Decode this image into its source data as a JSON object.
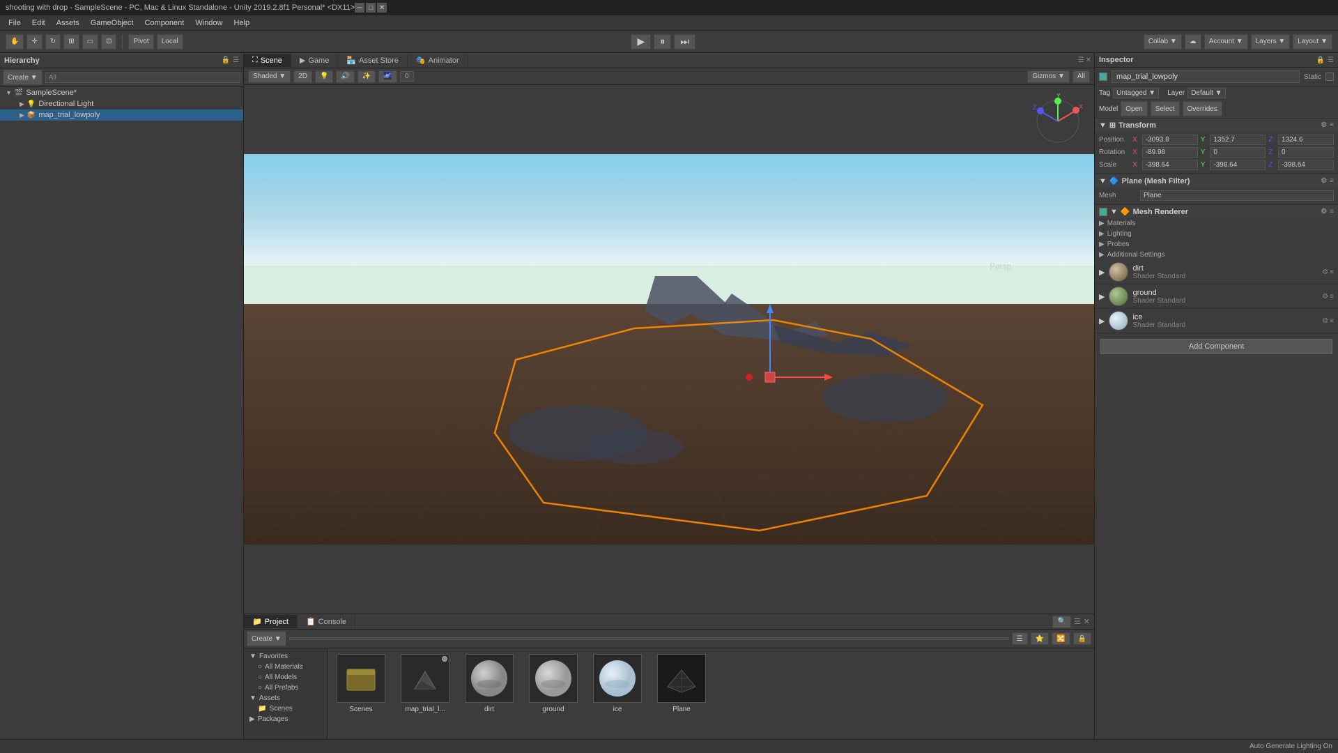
{
  "window": {
    "title": "shooting with drop - SampleScene - PC, Mac & Linux Standalone - Unity 2019.2.8f1 Personal* <DX11>"
  },
  "titlebar": {
    "title": "shooting with drop - SampleScene - PC, Mac & Linux Standalone - Unity 2019.2.8f1 Personal* <DX11>",
    "minimize": "─",
    "maximize": "□",
    "close": "✕"
  },
  "menubar": {
    "items": [
      "File",
      "Edit",
      "Assets",
      "GameObject",
      "Component",
      "Window",
      "Help"
    ]
  },
  "toolbar": {
    "pivot_label": "Pivot",
    "local_label": "Local",
    "collab_label": "Collab ▼",
    "cloud_label": "☁",
    "account_label": "Account ▼",
    "layers_label": "Layers ▼",
    "layout_label": "Layout ▼"
  },
  "hierarchy": {
    "panel_title": "Hierarchy",
    "create_label": "Create ▼",
    "search_placeholder": "All",
    "items": [
      {
        "name": "SampleScene*",
        "level": 0,
        "expanded": true
      },
      {
        "name": "Directional Light",
        "level": 1,
        "expanded": false
      },
      {
        "name": "map_trial_lowpoly",
        "level": 1,
        "expanded": false,
        "selected": true
      }
    ]
  },
  "scene": {
    "tabs": [
      "Scene",
      "Game",
      "Asset Store",
      "Animator"
    ],
    "active_tab": "Scene",
    "shading_mode": "Shaded",
    "view_mode": "2D",
    "gizmos_label": "Gizmos ▼",
    "all_label": "All"
  },
  "inspector": {
    "title": "Inspector",
    "object_name": "map_trial_lowpoly",
    "static_label": "Static",
    "tag_label": "Tag",
    "tag_value": "Untagged",
    "layer_label": "Layer",
    "layer_value": "Default",
    "model_label": "Model",
    "open_label": "Open",
    "select_label": "Select",
    "overrides_label": "Overrides",
    "transform": {
      "title": "Transform",
      "position_label": "Position",
      "position_x": "-3093.8",
      "position_y": "1352.7",
      "position_z": "1324.6",
      "rotation_label": "Rotation",
      "rotation_x": "-89.98",
      "rotation_y": "0",
      "rotation_z": "0",
      "scale_label": "Scale",
      "scale_x": "-398.64",
      "scale_y": "-398.64",
      "scale_z": "-398.64"
    },
    "plane_mesh_filter": {
      "title": "Plane (Mesh Filter)",
      "mesh_label": "Mesh",
      "mesh_value": "Plane"
    },
    "mesh_renderer": {
      "title": "Mesh Renderer",
      "materials_label": "Materials",
      "lighting_label": "Lighting",
      "probes_label": "Probes",
      "additional_label": "Additional Settings"
    },
    "materials": [
      {
        "name": "dirt",
        "shader": "Standard",
        "color": "#6B5A3E"
      },
      {
        "name": "ground",
        "shader": "Standard",
        "color": "#4A6B3A"
      },
      {
        "name": "ice",
        "shader": "Standard",
        "color": "#8AAABB"
      }
    ],
    "add_component_label": "Add Component"
  },
  "project": {
    "tabs": [
      "Project",
      "Console"
    ],
    "active_tab": "Project",
    "create_label": "Create ▼",
    "search_placeholder": "",
    "sidebar": {
      "items": [
        {
          "name": "Favorites",
          "expanded": true
        },
        {
          "name": "All Materials",
          "level": 1
        },
        {
          "name": "All Models",
          "level": 1
        },
        {
          "name": "All Prefabs",
          "level": 1
        },
        {
          "name": "Assets",
          "expanded": true
        },
        {
          "name": "Scenes",
          "level": 1
        },
        {
          "name": "Packages",
          "expanded": true
        }
      ]
    },
    "assets": [
      {
        "name": "Scenes",
        "type": "folder",
        "color": "#5a5a2a"
      },
      {
        "name": "map_trial_l...",
        "type": "model",
        "color": "#3a3a3a"
      },
      {
        "name": "dirt",
        "type": "material",
        "color": "#c0c0c0"
      },
      {
        "name": "ground",
        "type": "material",
        "color": "#c0c0c0"
      },
      {
        "name": "ice",
        "type": "material",
        "color": "#d0e0e8"
      },
      {
        "name": "Plane",
        "type": "mesh",
        "color": "#444"
      }
    ]
  },
  "statusbar": {
    "text": "Auto Generate Lighting On"
  }
}
